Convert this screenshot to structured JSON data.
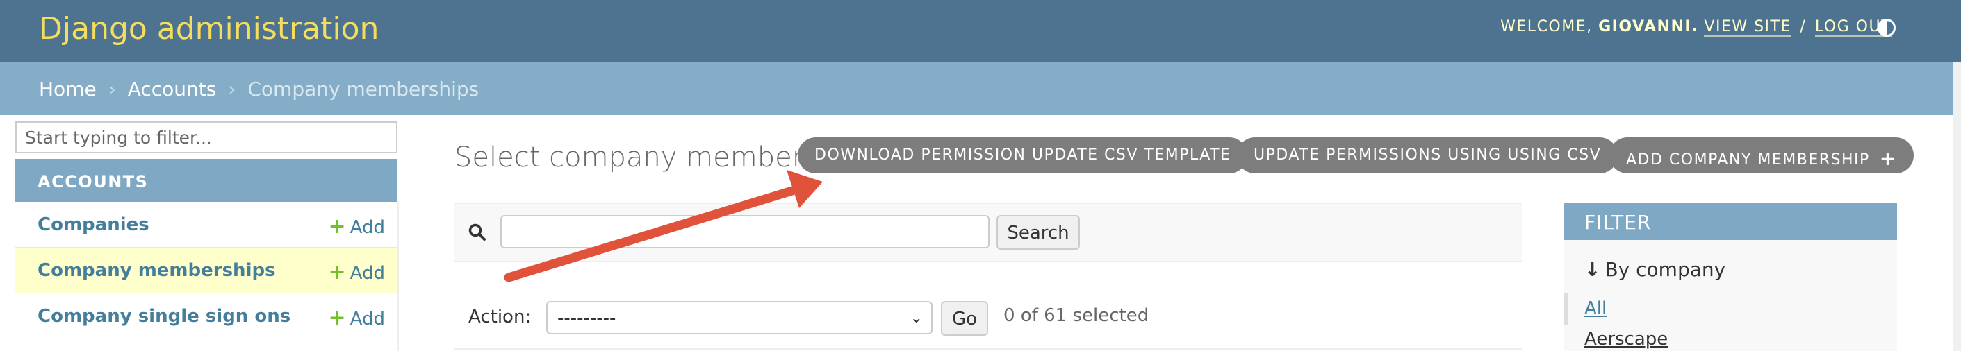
{
  "header": {
    "brand": "Django administration",
    "welcome": "WELCOME,",
    "username": "GIOVANNI.",
    "view_site": "VIEW SITE",
    "separator": "/",
    "log_out": "LOG OUT",
    "theme_icon": "theme-toggle-icon"
  },
  "breadcrumbs": {
    "home": "Home",
    "app": "Accounts",
    "current": "Company memberships",
    "separator": "›"
  },
  "sidebar": {
    "filter_placeholder": "Start typing to filter...",
    "app_caption": "ACCOUNTS",
    "add_label": "Add",
    "items": [
      {
        "label": "Companies",
        "active": false
      },
      {
        "label": "Company memberships",
        "active": true
      },
      {
        "label": "Company single sign ons",
        "active": false
      }
    ]
  },
  "content": {
    "title": "Select company membership to change",
    "object_tools": [
      "DOWNLOAD PERMISSION UPDATE CSV TEMPLATE",
      "UPDATE PERMISSIONS USING USING CSV",
      "ADD COMPANY MEMBERSHIP"
    ],
    "search": {
      "value": "",
      "button": "Search"
    },
    "actions": {
      "label": "Action:",
      "selected_option": "---------",
      "go": "Go",
      "counter": "0 of 61 selected"
    }
  },
  "filter": {
    "header": "FILTER",
    "by_label": "By company",
    "options": [
      "All",
      "Aerscape"
    ]
  },
  "colors": {
    "header_bg": "#4e7390",
    "brand": "#f5dd5d",
    "breadcrumb_bg": "#85adc8",
    "caption_bg": "#7ea8c4",
    "link": "#447e9b",
    "active_row": "#ffffcc",
    "add_icon": "#70bf2b",
    "annotation_arrow": "#e0523a"
  }
}
